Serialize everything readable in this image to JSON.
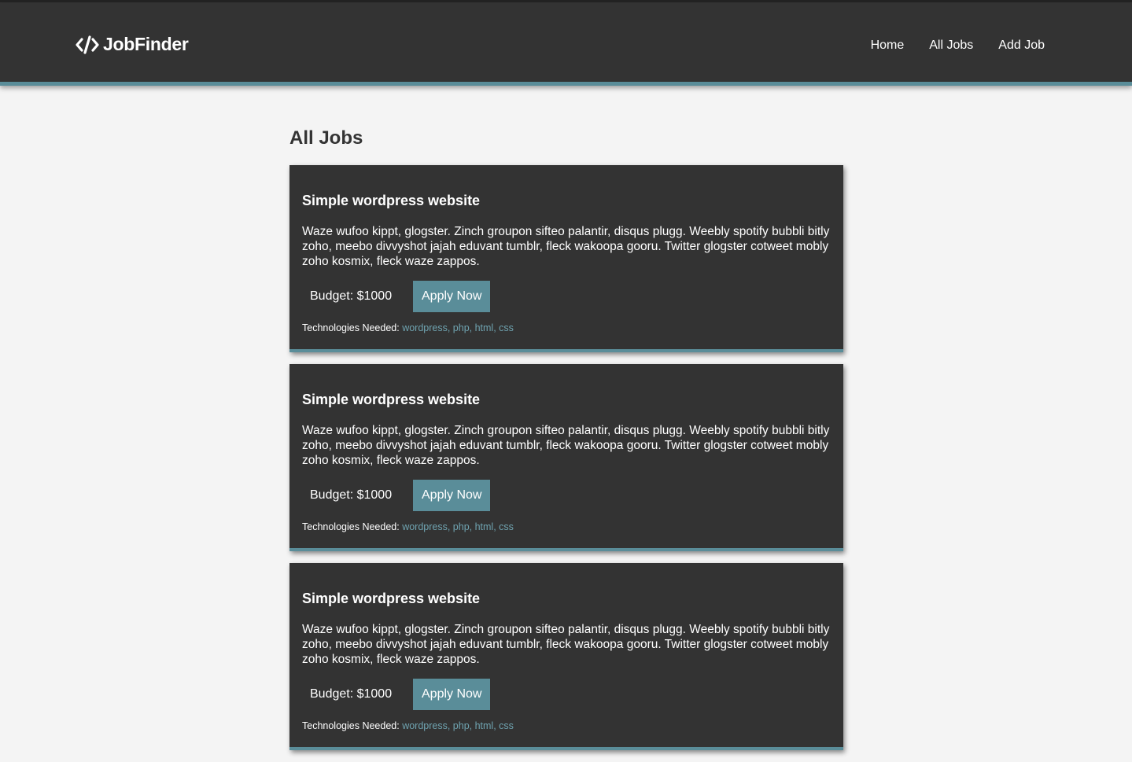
{
  "header": {
    "brand": "JobFinder",
    "nav": [
      "Home",
      "All Jobs",
      "Add Job"
    ]
  },
  "page_title": "All Jobs",
  "jobs": [
    {
      "title": "Simple wordpress website",
      "description": "Waze wufoo kippt, glogster. Zinch groupon sifteo palantir, disqus plugg. Weebly spotify bubbli bitly zoho, meebo divvyshot jajah eduvant tumblr, fleck wakoopa gooru. Twitter glogster cotweet mobly zoho kosmix, fleck waze zappos.",
      "budget": "Budget: $1000",
      "apply_label": "Apply Now",
      "tech_label": "Technologies Needed:",
      "technologies": "wordpress, php, html, css"
    },
    {
      "title": "Simple wordpress website",
      "description": "Waze wufoo kippt, glogster. Zinch groupon sifteo palantir, disqus plugg. Weebly spotify bubbli bitly zoho, meebo divvyshot jajah eduvant tumblr, fleck wakoopa gooru. Twitter glogster cotweet mobly zoho kosmix, fleck waze zappos.",
      "budget": "Budget: $1000",
      "apply_label": "Apply Now",
      "tech_label": "Technologies Needed:",
      "technologies": "wordpress, php, html, css"
    },
    {
      "title": "Simple wordpress website",
      "description": "Waze wufoo kippt, glogster. Zinch groupon sifteo palantir, disqus plugg. Weebly spotify bubbli bitly zoho, meebo divvyshot jajah eduvant tumblr, fleck wakoopa gooru. Twitter glogster cotweet mobly zoho kosmix, fleck waze zappos.",
      "budget": "Budget: $1000",
      "apply_label": "Apply Now",
      "tech_label": "Technologies Needed:",
      "technologies": "wordpress, php, html, css"
    }
  ],
  "colors": {
    "header_bg": "#333333",
    "accent": "#5a8d99",
    "page_bg": "#f4f4f4",
    "card_bg": "#333333"
  },
  "icons": {
    "brand_icon": "code-icon"
  }
}
